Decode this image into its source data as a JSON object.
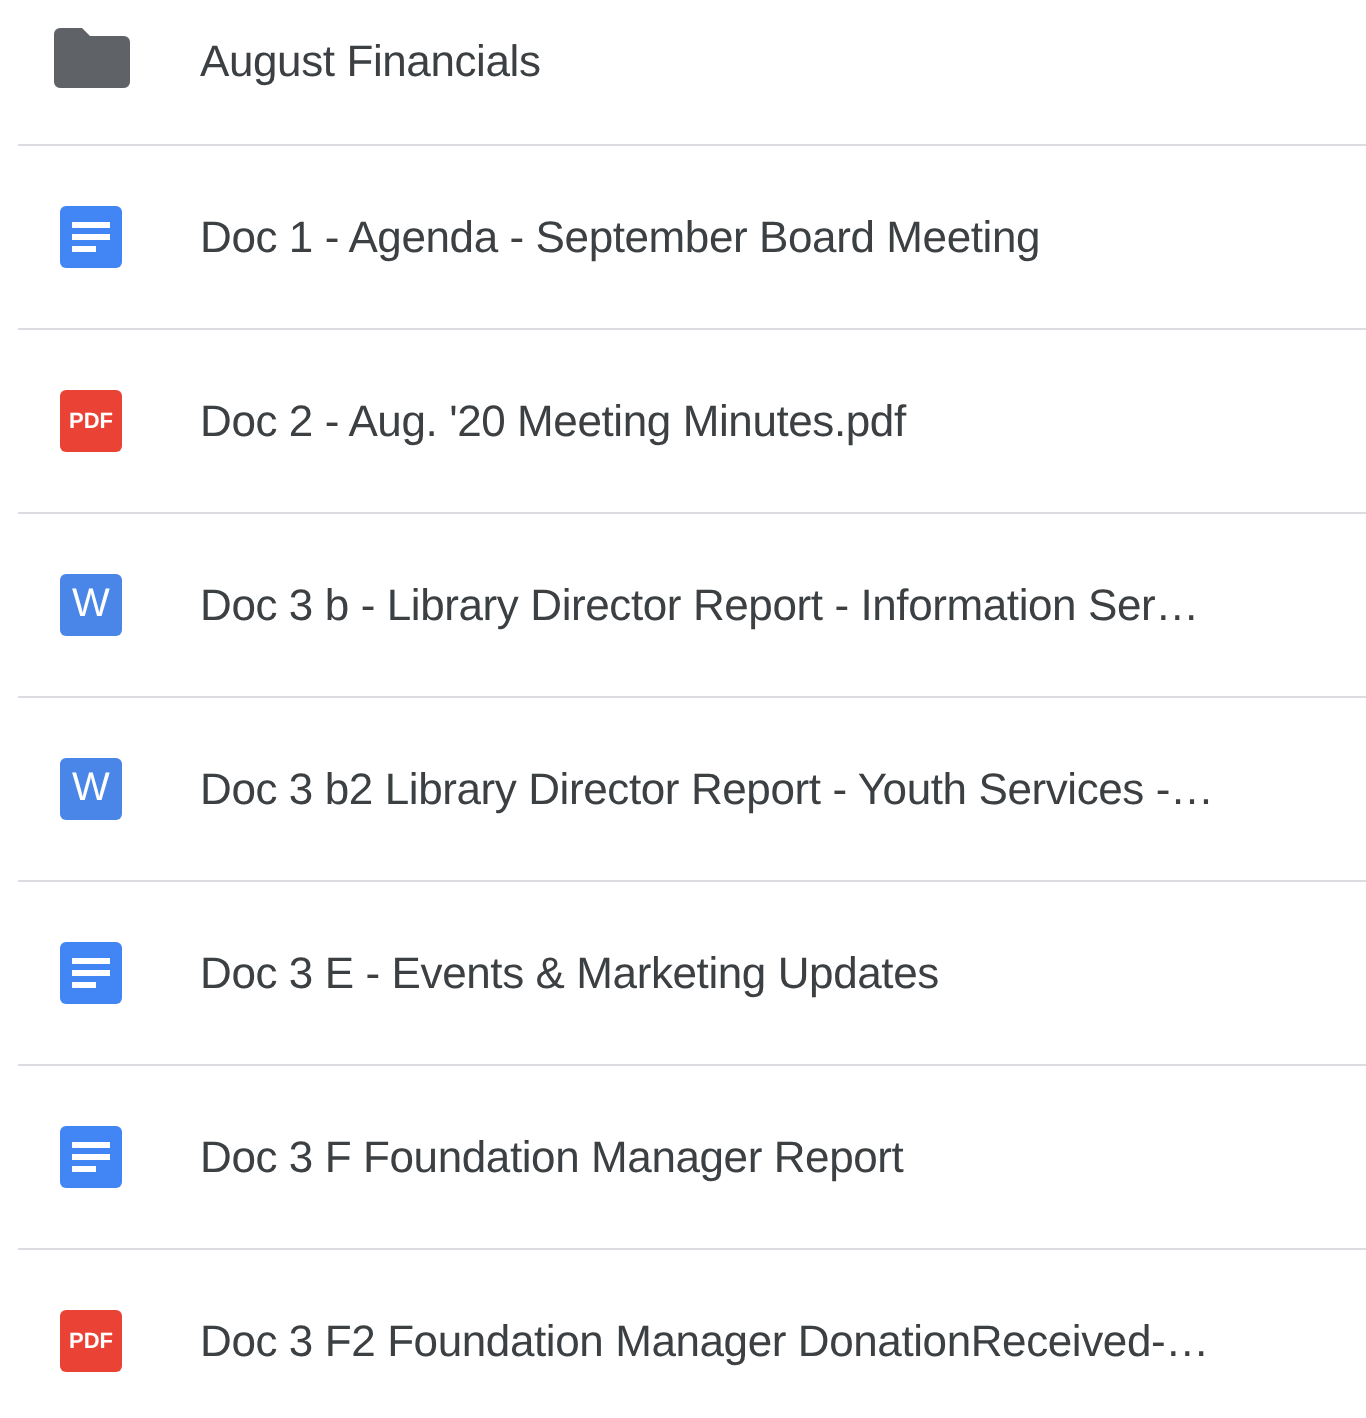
{
  "files": [
    {
      "kind": "folder",
      "name": "August Financials"
    },
    {
      "kind": "doc",
      "name": "Doc 1 - Agenda - September Board Meeting"
    },
    {
      "kind": "pdf",
      "icon_label": "PDF",
      "name": "Doc 2 - Aug. '20 Meeting Minutes.pdf"
    },
    {
      "kind": "word",
      "icon_label": "W",
      "name": "Doc 3 b - Library Director Report - Information Ser…"
    },
    {
      "kind": "word",
      "icon_label": "W",
      "name": "Doc 3 b2 Library Director Report - Youth Services -…"
    },
    {
      "kind": "doc",
      "name": "Doc 3 E - Events & Marketing Updates"
    },
    {
      "kind": "doc",
      "name": "Doc 3 F Foundation Manager Report"
    },
    {
      "kind": "pdf",
      "icon_label": "PDF",
      "name": "Doc 3 F2 Foundation Manager DonationReceived-…"
    }
  ]
}
